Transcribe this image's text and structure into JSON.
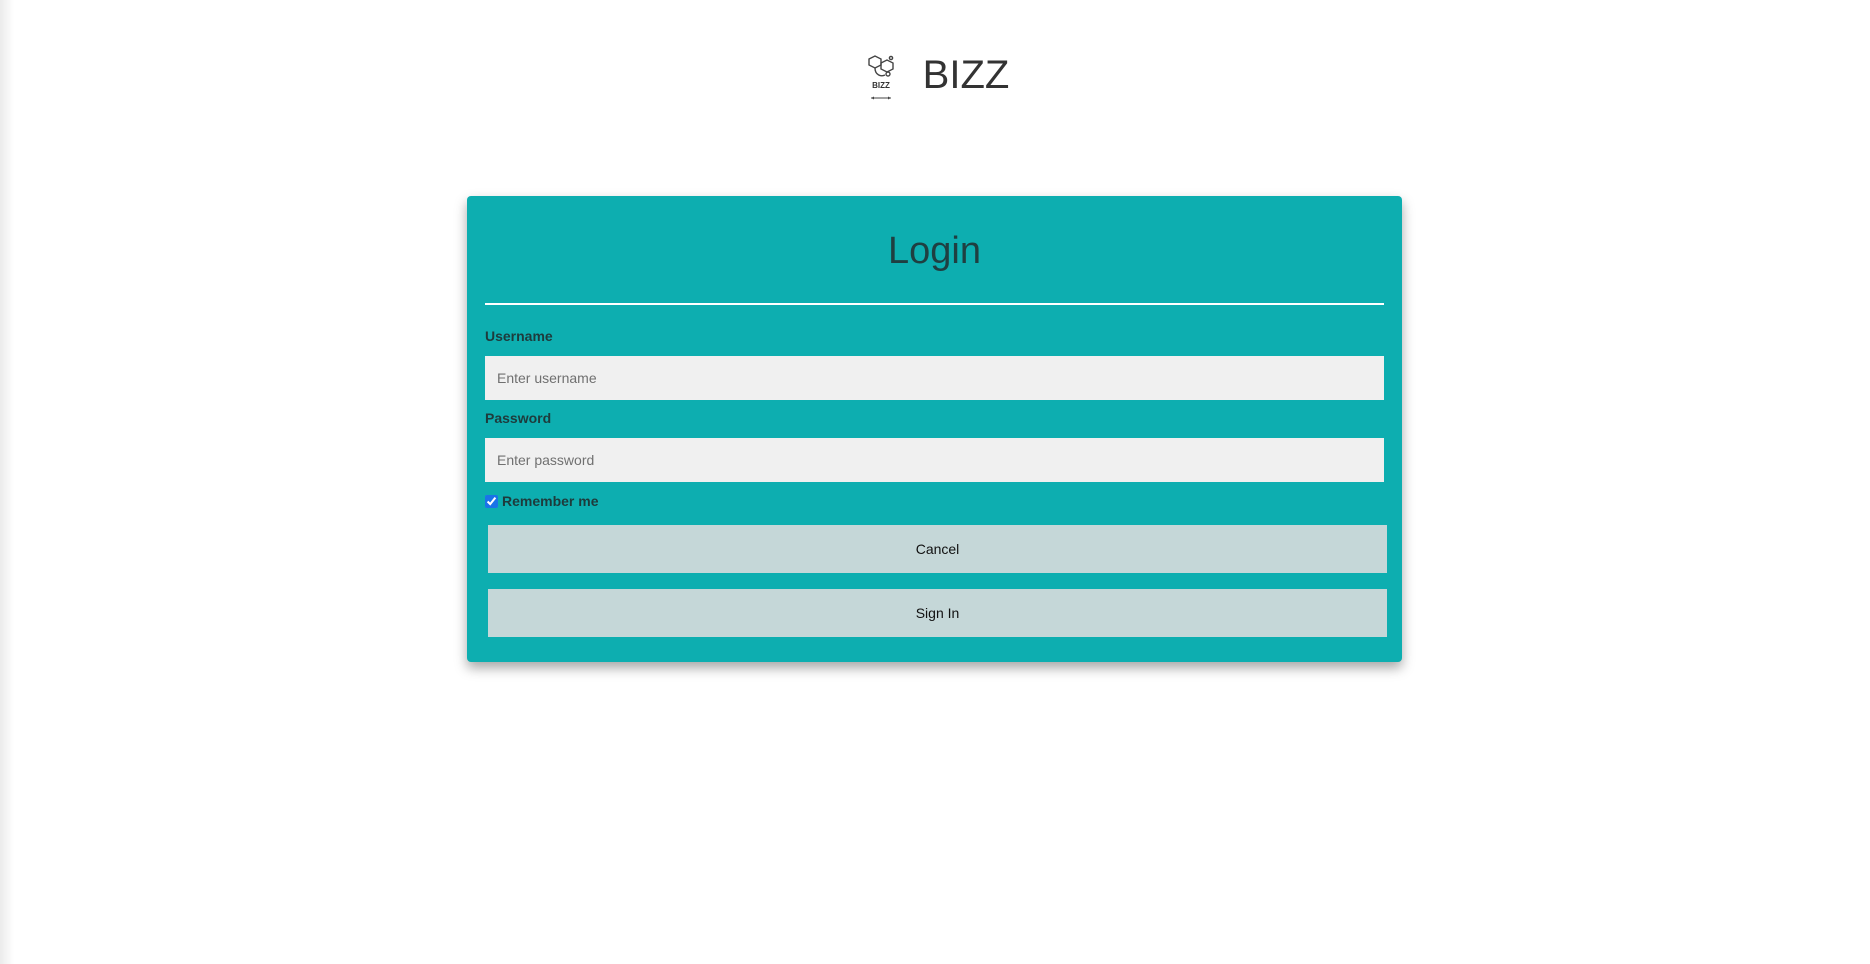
{
  "header": {
    "brand": "BIZZ",
    "logo_icon": "bizz-logo-icon",
    "logo_text": "BIZZ"
  },
  "login": {
    "title": "Login",
    "username_label": "Username",
    "username_placeholder": "Enter username",
    "username_value": "",
    "password_label": "Password",
    "password_placeholder": "Enter password",
    "password_value": "",
    "remember_label": "Remember me",
    "remember_checked": true,
    "cancel_label": "Cancel",
    "signin_label": "Sign In"
  },
  "colors": {
    "card_background": "#0daeb0",
    "button_background": "#c5d7d8",
    "input_background": "#f0f0f0",
    "title_text": "#1f3f41"
  }
}
